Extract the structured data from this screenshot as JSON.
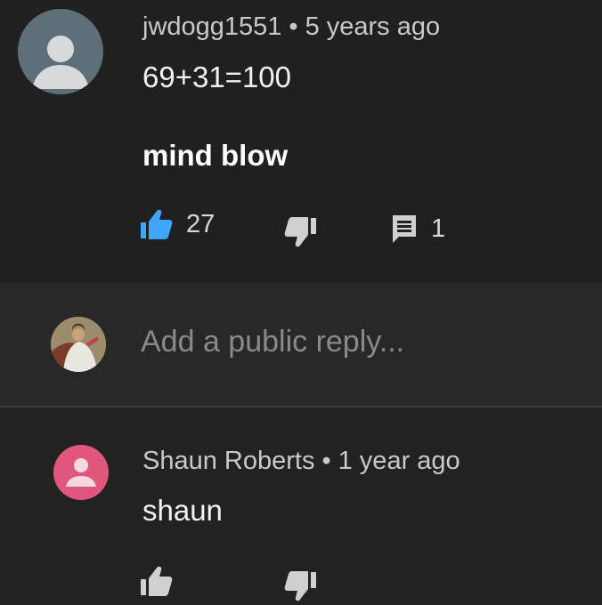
{
  "comments": [
    {
      "author": "jwdogg1551",
      "time": "5 years ago",
      "lines": [
        "69+31=100",
        "mind blow"
      ],
      "likes": "27",
      "replies": "1",
      "avatar_color": "#5f6f7a"
    },
    {
      "author": "Shaun Roberts",
      "time": "1 year ago",
      "lines": [
        "shaun"
      ],
      "avatar_color": "#e0567c"
    }
  ],
  "reply_bar": {
    "placeholder": "Add a public reply..."
  },
  "colors": {
    "like_active": "#3ea6ff",
    "icon_gray": "#d0d0d0"
  },
  "separator": "•"
}
